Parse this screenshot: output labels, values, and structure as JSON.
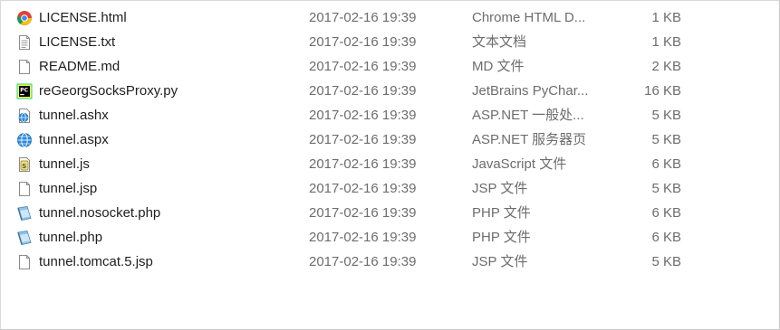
{
  "files": [
    {
      "name": "LICENSE.html",
      "date": "2017-02-16 19:39",
      "type": "Chrome HTML D...",
      "size": "1 KB",
      "icon": "chrome-icon"
    },
    {
      "name": "LICENSE.txt",
      "date": "2017-02-16 19:39",
      "type": "文本文档",
      "size": "1 KB",
      "icon": "text-file-icon"
    },
    {
      "name": "README.md",
      "date": "2017-02-16 19:39",
      "type": "MD 文件",
      "size": "2 KB",
      "icon": "blank-file-icon"
    },
    {
      "name": "reGeorgSocksProxy.py",
      "date": "2017-02-16 19:39",
      "type": "JetBrains PyChar...",
      "size": "16 KB",
      "icon": "pycharm-icon"
    },
    {
      "name": "tunnel.ashx",
      "date": "2017-02-16 19:39",
      "type": "ASP.NET 一般处...",
      "size": "5 KB",
      "icon": "aspnet-handler-icon"
    },
    {
      "name": "tunnel.aspx",
      "date": "2017-02-16 19:39",
      "type": "ASP.NET 服务器页",
      "size": "5 KB",
      "icon": "globe-icon"
    },
    {
      "name": "tunnel.js",
      "date": "2017-02-16 19:39",
      "type": "JavaScript 文件",
      "size": "6 KB",
      "icon": "script-icon"
    },
    {
      "name": "tunnel.jsp",
      "date": "2017-02-16 19:39",
      "type": "JSP 文件",
      "size": "5 KB",
      "icon": "blank-file-icon"
    },
    {
      "name": "tunnel.nosocket.php",
      "date": "2017-02-16 19:39",
      "type": "PHP 文件",
      "size": "6 KB",
      "icon": "php-file-icon"
    },
    {
      "name": "tunnel.php",
      "date": "2017-02-16 19:39",
      "type": "PHP 文件",
      "size": "6 KB",
      "icon": "php-file-icon"
    },
    {
      "name": "tunnel.tomcat.5.jsp",
      "date": "2017-02-16 19:39",
      "type": "JSP 文件",
      "size": "5 KB",
      "icon": "blank-file-icon"
    }
  ]
}
